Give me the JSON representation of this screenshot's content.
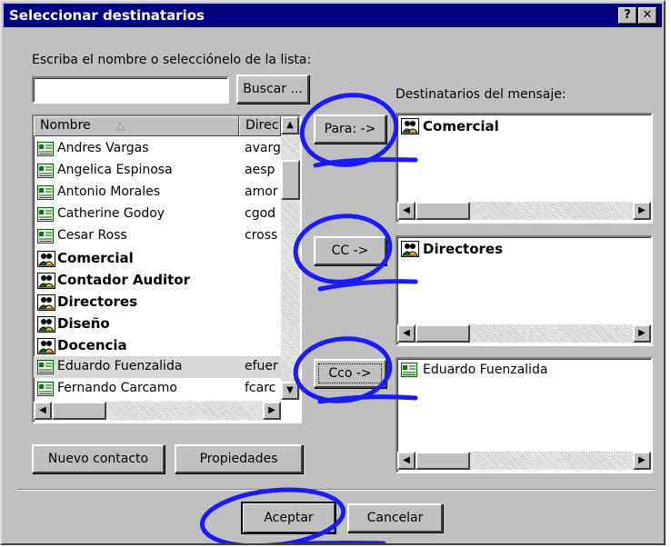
{
  "window": {
    "title": "Seleccionar destinatarios",
    "help_button": "?",
    "close_button": "✕"
  },
  "search": {
    "instruction": "Escriba el nombre o selecciónelo de la lista:",
    "input_value": "",
    "button_label": "Buscar ..."
  },
  "list": {
    "columns": [
      "Nombre",
      "Direc"
    ],
    "rows": [
      {
        "name": "Andres Vargas",
        "email": "avarg",
        "type": "contact"
      },
      {
        "name": "Angelica Espinosa",
        "email": "aesp",
        "type": "contact"
      },
      {
        "name": "Antonio Morales",
        "email": "amor",
        "type": "contact"
      },
      {
        "name": "Catherine Godoy",
        "email": "cgod",
        "type": "contact"
      },
      {
        "name": "Cesar Ross",
        "email": "cross",
        "type": "contact"
      },
      {
        "name": "Comercial",
        "email": "",
        "type": "group"
      },
      {
        "name": "Contador Auditor",
        "email": "",
        "type": "group"
      },
      {
        "name": "Directores",
        "email": "",
        "type": "group"
      },
      {
        "name": "Diseño",
        "email": "",
        "type": "group"
      },
      {
        "name": "Docencia",
        "email": "",
        "type": "group"
      },
      {
        "name": "Eduardo Fuenzalida",
        "email": "efuer",
        "type": "contact",
        "selected": true
      },
      {
        "name": "Fernando Carcamo",
        "email": "fcarc",
        "type": "contact"
      }
    ]
  },
  "buttons": {
    "new_contact": "Nuevo contacto",
    "properties": "Propiedades",
    "to": "Para: ->",
    "cc": "CC ->",
    "bcc": "Cco ->",
    "ok": "Aceptar",
    "cancel": "Cancelar"
  },
  "recipients": {
    "label": "Destinatarios del mensaje:",
    "to": [
      {
        "name": "Comercial",
        "type": "group"
      }
    ],
    "cc": [
      {
        "name": "Directores",
        "type": "group"
      }
    ],
    "bcc": [
      {
        "name": "Eduardo Fuenzalida",
        "type": "contact"
      }
    ]
  },
  "colors": {
    "titlebar": "#000080",
    "window": "#c0c0c0",
    "annotation": "#1a1aff"
  },
  "icons": {
    "contact": "contact-card-icon",
    "group": "group-icon",
    "sort": "sort-triangle-icon"
  }
}
